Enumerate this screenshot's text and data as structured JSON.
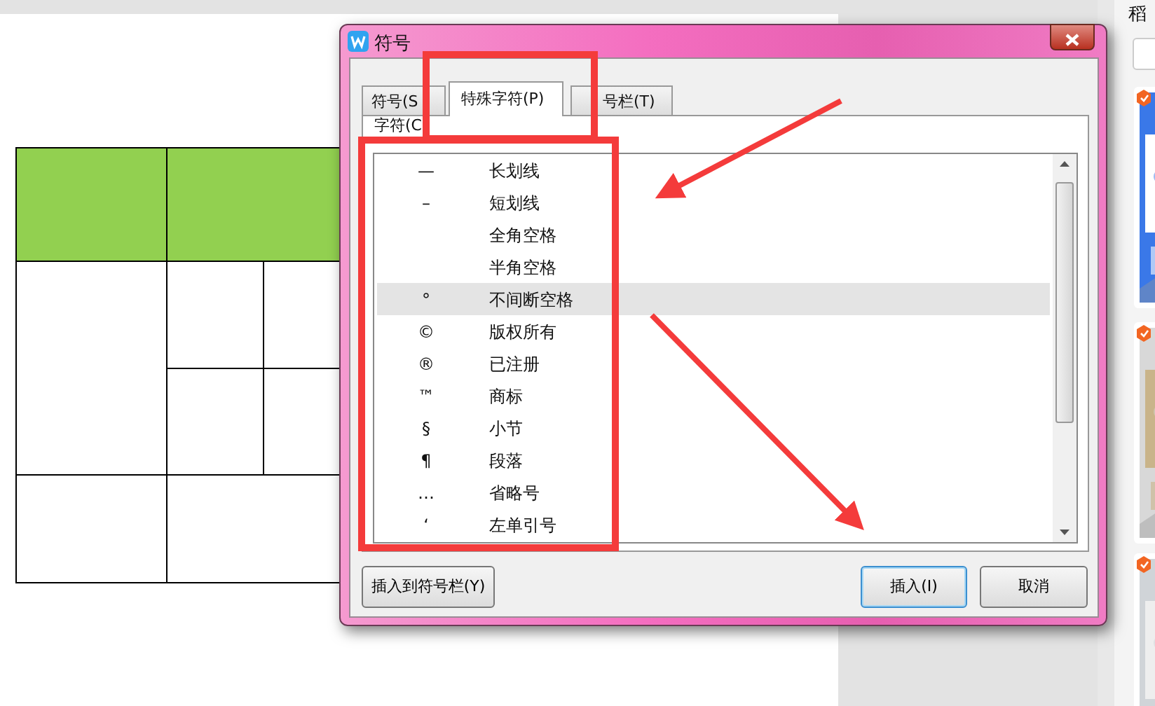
{
  "dialog": {
    "title": "符号",
    "tabs": [
      {
        "label": "符号(S",
        "selected": false
      },
      {
        "label": "特殊字符(P)",
        "selected": true
      },
      {
        "label": "号栏(T)",
        "selected": false
      }
    ],
    "list_label": "字符(C",
    "rows": [
      {
        "symbol": "—",
        "name": "长划线",
        "selected": false
      },
      {
        "symbol": "–",
        "name": "短划线",
        "selected": false
      },
      {
        "name": "全角空格",
        "selected": false
      },
      {
        "name": "半角空格",
        "selected": false
      },
      {
        "symbol": "°",
        "name": "不间断空格",
        "selected": true
      },
      {
        "symbol": "©",
        "name": "版权所有",
        "selected": false
      },
      {
        "symbol": "®",
        "name": "已注册",
        "selected": false
      },
      {
        "symbol": "™",
        "name": "商标",
        "selected": false
      },
      {
        "symbol": "§",
        "name": "小节",
        "selected": false
      },
      {
        "symbol": "¶",
        "name": "段落",
        "selected": false
      },
      {
        "symbol": "…",
        "name": "省略号",
        "selected": false
      },
      {
        "symbol": "‘",
        "name": "左单引号",
        "selected": false
      }
    ],
    "buttons": [
      {
        "label": "插入到符号栏(Y)",
        "kind": "left"
      },
      {
        "label": "插入(I)",
        "kind": "default"
      },
      {
        "label": "取消",
        "kind": "plain"
      }
    ]
  },
  "side_panel": {
    "title": "稻"
  }
}
